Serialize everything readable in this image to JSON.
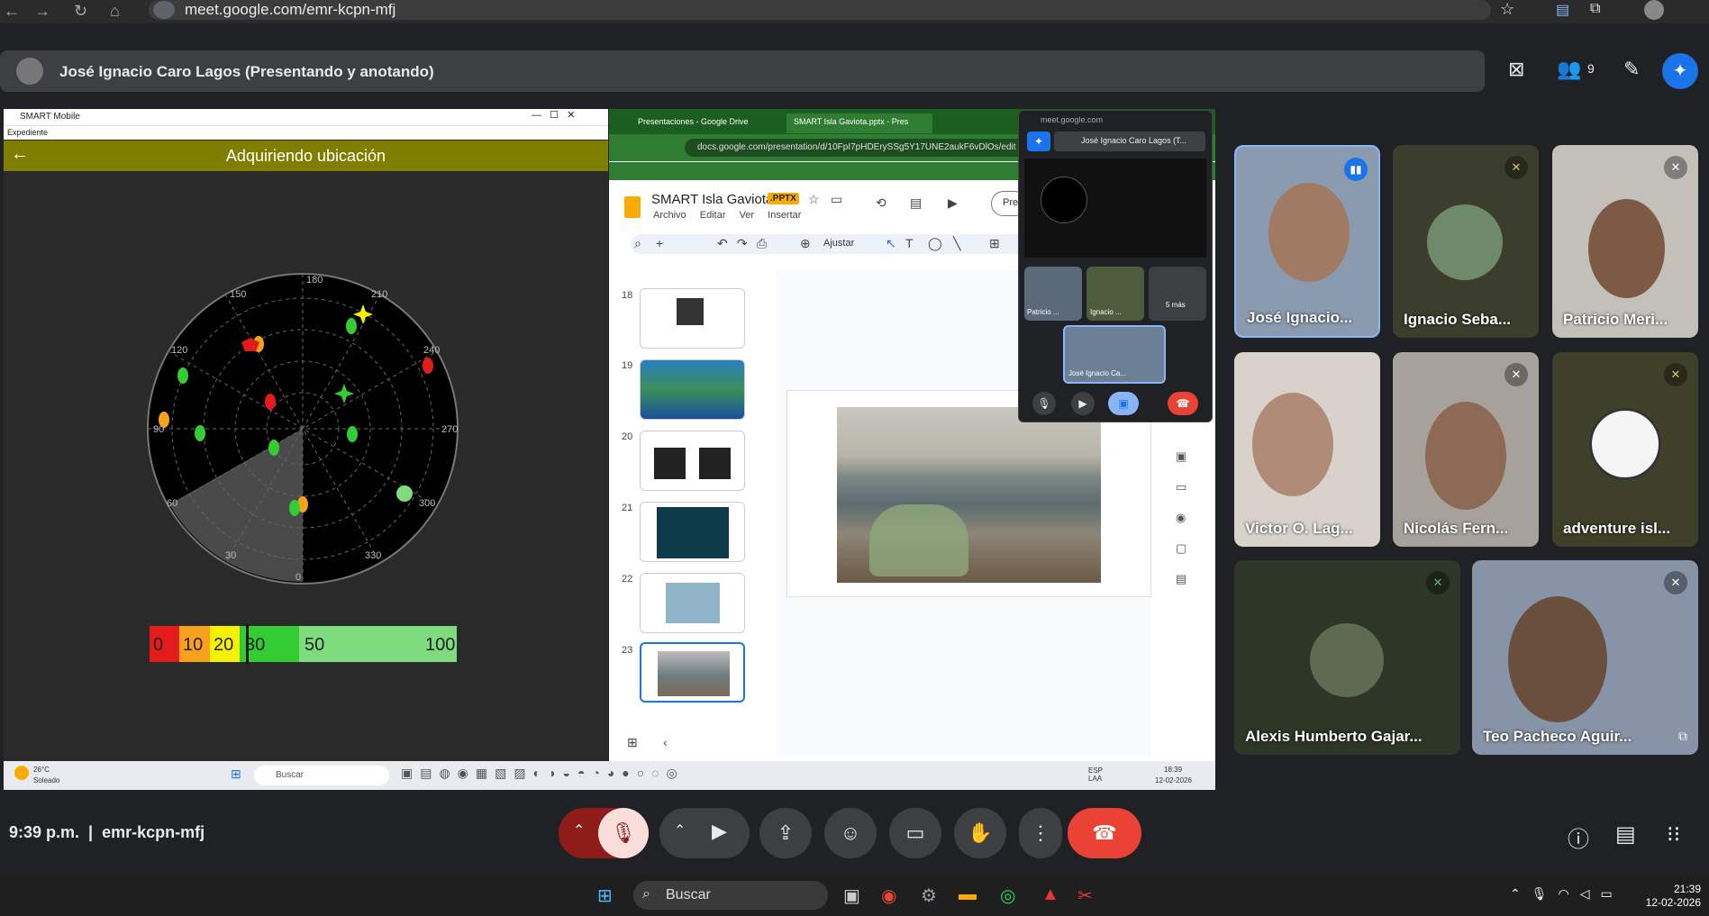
{
  "browser": {
    "url": "meet.google.com/emr-kcpn-mfj"
  },
  "presenter_bar": {
    "title": "José Ignacio Caro Lagos (Presentando y anotando)",
    "participant_count": "9"
  },
  "smart_app": {
    "window_title": "SMART Mobile",
    "menu": "Expediente",
    "header": "Adquiriendo ubicación",
    "compass_labels": [
      "180",
      "150",
      "120",
      "90",
      "60",
      "30",
      "0",
      "330",
      "300",
      "270",
      "240",
      "210"
    ],
    "scale_labels": [
      "0",
      "10",
      "20",
      "30",
      "50",
      "100"
    ],
    "colors": {
      "header": "#7f7e00",
      "red": "#e31b1b",
      "orange": "#f7a11c",
      "yellow": "#f4f200",
      "green": "#33cc33",
      "lightgreen": "#7edb7e"
    }
  },
  "slides": {
    "tab1": "Presentaciones - Google Drive",
    "tab2": "SMART Isla Gaviota.pptx - Pres",
    "url": "docs.google.com/presentation/d/10FpI7pHDErySSg5Y17UNE2aukF6vDlOs/edit",
    "doc_name": "SMART Isla Gaviota",
    "badge": ".PPTX",
    "menu": [
      "Archivo",
      "Editar",
      "Ver",
      "Insertar"
    ],
    "present_btn": "Pre",
    "zoom": "Ajustar",
    "thumb_numbers": [
      "18",
      "19",
      "20",
      "21",
      "22",
      "23"
    ],
    "pip_url": "meet.google.com",
    "pip_presenter": "José Ignacio Caro Lagos (T...",
    "pip_tiles": [
      "Patricio ...",
      "Ignacio ...",
      "5 más",
      "José Ignacio Ca..."
    ]
  },
  "inner_taskbar": {
    "weather_temp": "26°C",
    "weather_desc": "Soleado",
    "search": "Buscar",
    "lang": "ESP\nLAA",
    "time": "18:39",
    "date": "12-02-2026"
  },
  "participants": [
    {
      "name": "José Ignacio...",
      "speaking": true
    },
    {
      "name": "Ignacio Seba...",
      "muted": true
    },
    {
      "name": "Patricio Meri...",
      "muted": true
    },
    {
      "name": "Victor O. Lag..."
    },
    {
      "name": "Nicolás Fern...",
      "muted": true
    },
    {
      "name": "adventure isl...",
      "muted": true
    },
    {
      "name": "Alexis Humberto Gajar...",
      "muted": true
    },
    {
      "name": "Teo Pacheco Aguir...",
      "muted": true
    }
  ],
  "meeting": {
    "time": "9:39 p.m.",
    "code": "emr-kcpn-mfj"
  },
  "os_taskbar": {
    "search": "Buscar",
    "time": "21:39",
    "date": "12-02-2026"
  },
  "icons": {
    "back": "arrow-left",
    "forward": "arrow-right",
    "reload": "reload",
    "home": "home",
    "star": "star",
    "mic_off": "mic-off",
    "camera": "camera",
    "present": "present",
    "emoji": "emoji",
    "captions": "captions",
    "hand": "raise-hand",
    "more": "more-vert",
    "hangup": "hangup",
    "info": "info",
    "chat": "chat",
    "activities": "apps-grid"
  },
  "accent": {
    "meet_blue": "#1a73e8",
    "hangup_red": "#ea4335",
    "mic_red": "#8e1c18"
  }
}
